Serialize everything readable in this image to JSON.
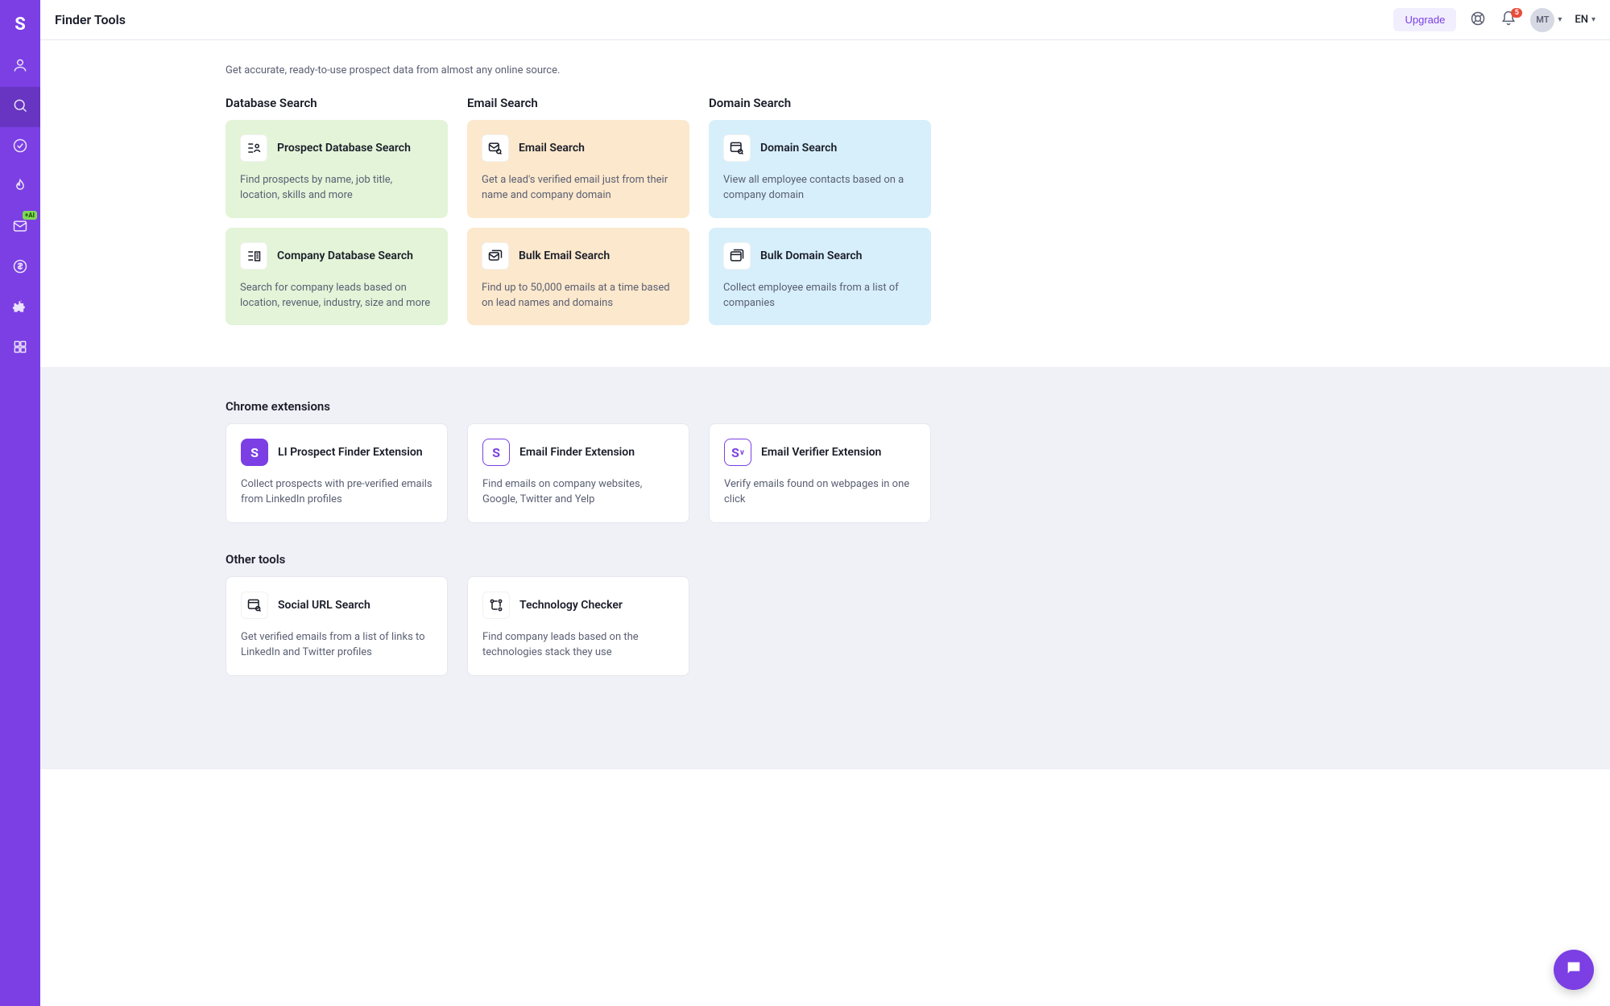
{
  "topbar": {
    "title": "Finder Tools",
    "upgrade": "Upgrade",
    "notif_count": "5",
    "avatar_initials": "MT",
    "language": "EN"
  },
  "sidebar": {
    "logo": "S",
    "ai_badge": "+AI"
  },
  "subheading": "Get accurate, ready-to-use prospect data from almost any online source.",
  "cols": {
    "database": {
      "heading": "Database Search",
      "cards": [
        {
          "title": "Prospect Database Search",
          "desc": "Find prospects by name, job title, location, skills and more"
        },
        {
          "title": "Company Database Search",
          "desc": "Search for company leads based on location, revenue, industry, size and more"
        }
      ]
    },
    "email": {
      "heading": "Email Search",
      "cards": [
        {
          "title": "Email Search",
          "desc": "Get a lead's verified email just from their name and company domain"
        },
        {
          "title": "Bulk Email Search",
          "desc": "Find up to 50,000 emails at a time based on lead names and domains"
        }
      ]
    },
    "domain": {
      "heading": "Domain Search",
      "cards": [
        {
          "title": "Domain Search",
          "desc": "View all employee contacts based on a company domain"
        },
        {
          "title": "Bulk Domain Search",
          "desc": "Collect employee emails from a list of companies"
        }
      ]
    }
  },
  "extensions": {
    "heading": "Chrome extensions",
    "cards": [
      {
        "icon_letter": "S",
        "title": "LI Prospect Finder Extension",
        "desc": "Collect prospects with pre-verified emails from LinkedIn profiles"
      },
      {
        "icon_letter": "S",
        "title": "Email Finder Extension",
        "desc": "Find emails on company websites, Google, Twitter and Yelp"
      },
      {
        "icon_letter": "S",
        "icon_sub": "v",
        "title": "Email Verifier Extension",
        "desc": "Verify emails found on webpages in one click"
      }
    ]
  },
  "other": {
    "heading": "Other tools",
    "cards": [
      {
        "title": "Social URL Search",
        "desc": "Get verified emails from a list of links to LinkedIn and Twitter profiles"
      },
      {
        "title": "Technology Checker",
        "desc": "Find company leads based on the technologies stack they use"
      }
    ]
  }
}
